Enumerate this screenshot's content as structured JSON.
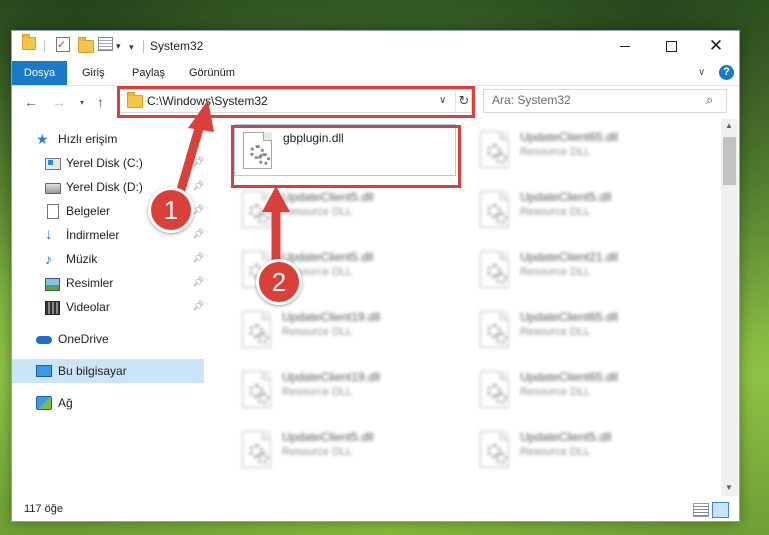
{
  "window": {
    "title": "System32",
    "buttons": {
      "minimize": "minimize",
      "maximize": "maximize",
      "close": "✕"
    }
  },
  "ribbon": {
    "tabs": [
      "Dosya",
      "Giriş",
      "Paylaş",
      "Görünüm"
    ],
    "active_tab": "Dosya",
    "help": "?"
  },
  "nav": {
    "address": "C:\\Windows\\System32",
    "search_placeholder": "Ara: System32"
  },
  "sidebar": {
    "quick_access": "Hızlı erişim",
    "items": [
      {
        "label": "Yerel Disk (C:)",
        "icon": "drive-c-icon",
        "pinned": true
      },
      {
        "label": "Yerel Disk (D:)",
        "icon": "drive-icon",
        "pinned": true
      },
      {
        "label": "Belgeler",
        "icon": "documents-icon",
        "pinned": true
      },
      {
        "label": "İndirmeler",
        "icon": "downloads-icon",
        "pinned": true
      },
      {
        "label": "Müzik",
        "icon": "music-icon",
        "pinned": true
      },
      {
        "label": "Resimler",
        "icon": "pictures-icon",
        "pinned": true
      },
      {
        "label": "Videolar",
        "icon": "videos-icon",
        "pinned": true
      }
    ],
    "onedrive": "OneDrive",
    "this_pc": "Bu bilgisayar",
    "network": "Ağ"
  },
  "files": {
    "selected": {
      "name": "gbplugin.dll",
      "type": ""
    },
    "left_column": [
      {
        "name": "UpdateClient5.dll",
        "type": "Resource DLL"
      },
      {
        "name": "UpdateClient5.dll",
        "type": "Resource DLL"
      },
      {
        "name": "UpdateClient19.dll",
        "type": "Resource DLL"
      },
      {
        "name": "UpdateClient19.dll",
        "type": "Resource DLL"
      },
      {
        "name": "UpdateClient5.dll",
        "type": "Resource DLL"
      }
    ],
    "right_column": [
      {
        "name": "UpdateClient65.dll",
        "type": "Resource DLL"
      },
      {
        "name": "UpdateClient5.dll",
        "type": "Resource DLL"
      },
      {
        "name": "UpdateClient21.dll",
        "type": "Resource DLL"
      },
      {
        "name": "UpdateClient65.dll",
        "type": "Resource DLL"
      },
      {
        "name": "UpdateClient65.dll",
        "type": "Resource DLL"
      },
      {
        "name": "UpdateClient5.dll",
        "type": "Resource DLL"
      }
    ]
  },
  "status": {
    "count": "117 öğe"
  },
  "annotations": {
    "step1": "1",
    "step2": "2",
    "color": "#d9403a"
  }
}
